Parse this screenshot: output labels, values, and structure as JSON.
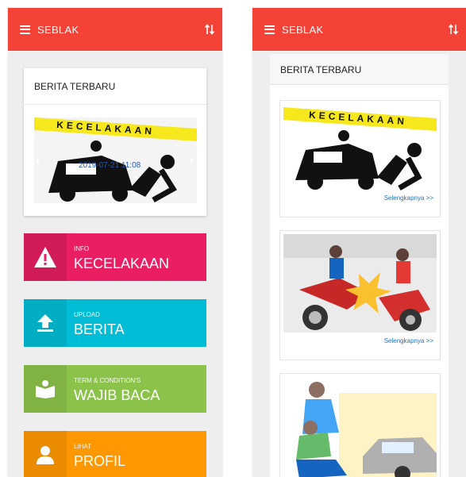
{
  "app": {
    "title": "SEBLAK"
  },
  "left": {
    "card_title": "BERITA TERBARU",
    "slide": {
      "banner_text": "KECELAKAAN",
      "date": "2019-07-21 11:08"
    },
    "tiles": [
      {
        "small": "INFO",
        "big": "KECELAKAAN",
        "color": "#e91e63",
        "icon": "warning-icon"
      },
      {
        "small": "UPLOAD",
        "big": "BERITA",
        "color": "#00bcd4",
        "icon": "upload-icon"
      },
      {
        "small": "TERM & CONDITION'S",
        "big": "WAJIB BACA",
        "color": "#8bc34a",
        "icon": "book-icon"
      },
      {
        "small": "LIHAT",
        "big": "PROFIL",
        "color": "#ff9800",
        "icon": "person-icon"
      }
    ]
  },
  "right": {
    "header": "BERITA TERBARU",
    "news": [
      {
        "banner_text": "KECELAKAAN",
        "link": "Selengkapnya >>"
      },
      {
        "link": "Selengkapnya >>"
      },
      {}
    ]
  },
  "colors": {
    "appbar": "#f44336",
    "background": "#eeeeee",
    "link": "#1e73be"
  }
}
